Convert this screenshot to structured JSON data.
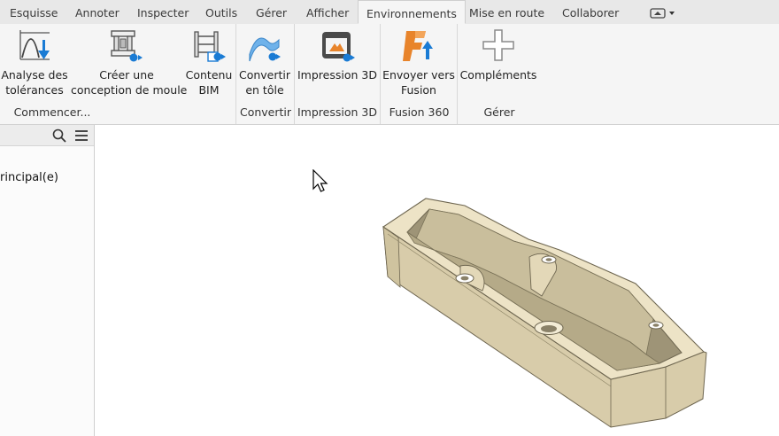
{
  "tabs": [
    "Esquisse",
    "Annoter",
    "Inspecter",
    "Outils",
    "Gérer",
    "Afficher",
    "Environnements",
    "Mise en route",
    "Collaborer"
  ],
  "active_tab": "Environnements",
  "ribbon": {
    "buttons": [
      {
        "line1": "Analyse des",
        "line2": "tolérances",
        "icon": "tolerance-analysis-icon"
      },
      {
        "line1": "Créer une",
        "line2": "conception de moule",
        "icon": "mold-design-icon"
      },
      {
        "line1": "Contenu",
        "line2": "BIM",
        "icon": "bim-content-icon"
      },
      {
        "line1": "Convertir",
        "line2": "en tôle",
        "icon": "sheet-metal-icon"
      },
      {
        "line1": "Impression 3D",
        "line2": "",
        "icon": "3d-print-icon"
      },
      {
        "line1": "Envoyer vers",
        "line2": "Fusion",
        "icon": "fusion-icon"
      },
      {
        "line1": "Compléments",
        "line2": "",
        "icon": "add-ins-icon"
      }
    ],
    "groups": [
      "Commencer...",
      "Convertir",
      "Impression 3D",
      "Fusion 360",
      "Gérer"
    ]
  },
  "browser": {
    "item_label": "rincipal(e)"
  },
  "colors": {
    "accent_blue": "#1a7bd4",
    "part_fill": "#ede3c6",
    "part_edge": "#6e6650",
    "fusion_orange": "#e8842b"
  }
}
